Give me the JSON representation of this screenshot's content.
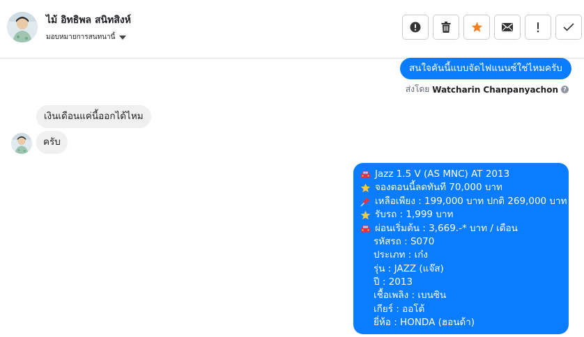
{
  "header": {
    "contact_name": "ไม้ อิทธิพล สนิทสิงห์",
    "assign_label": "มอบหมายการสนทนานี้",
    "actions": [
      "spam-icon",
      "trash-icon",
      "star-icon",
      "envelope-icon",
      "exclamation-icon",
      "check-icon"
    ],
    "accent_star": "#f5821f"
  },
  "messages": {
    "out_first": "สนใจคันนี้แบบจัดไฟแนนซ์ใช่ไหมครับ",
    "sent_by_prefix": "ส่งโดย",
    "sent_by_name": "Watcharin Chanpanyachon",
    "in_first": "เงินเดือนแค่นี้ออกได้ไหม",
    "in_second": "ครับ",
    "listing": {
      "title": "Jazz 1.5 V (AS MNC) AT 2013",
      "reserve": "จองตอนนี้ลดทันที 70,000 บาท",
      "remaining": "เหลือเพียง : 199,000 บาท ปกติ 269,000 บาท",
      "pickup": "รับรถ : 1,999 บาท",
      "installment": "ผ่อนเริ่มต้น : 3,669.-* บาท / เดือน",
      "code": "รหัสรถ : S070",
      "type": "ประเภท : เก๋ง",
      "model": "รุ่น : JAZZ (แจ๊ส)",
      "year": "ปี : 2013",
      "fuel": "เชื้อเพลิง : เบนซิน",
      "gear": "เกียร์ : ออโต้",
      "brand": "ยี่ห้อ : HONDA (ฮอนด้า)"
    },
    "colors": {
      "outgoing": "#0a7cff",
      "incoming": "#f0f0f0"
    }
  }
}
